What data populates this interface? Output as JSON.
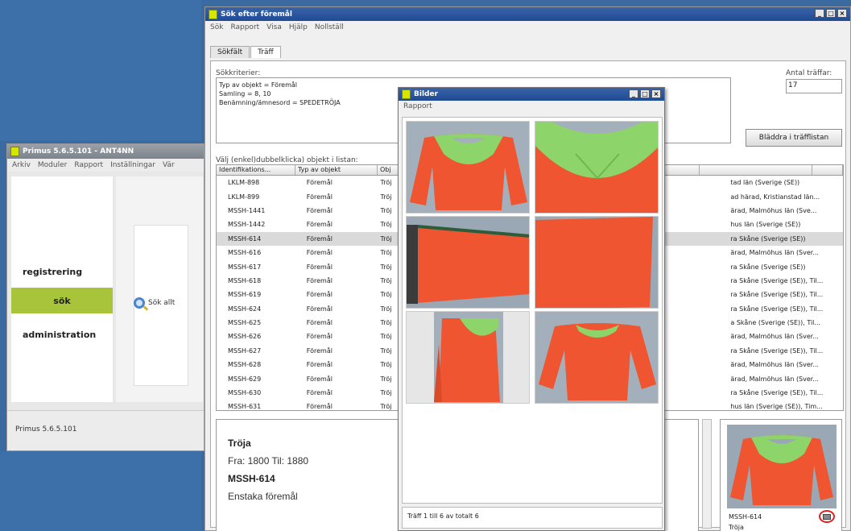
{
  "primus": {
    "title": "Primus 5.6.5.101 - ANT4NN",
    "menu": [
      "Arkiv",
      "Moduler",
      "Rapport",
      "Inställningar",
      "Vär"
    ],
    "nav": [
      "registrering",
      "sök",
      "administration"
    ],
    "side_link": "Sök allt",
    "status": "Primus 5.6.5.101"
  },
  "search": {
    "title": "Sök efter föremål",
    "menu": [
      "Sök",
      "Rapport",
      "Visa",
      "Hjälp",
      "Nollställ"
    ],
    "tabs": [
      "Sökfält",
      "Träff"
    ],
    "criteria_label": "Sökkriterier:",
    "criteria_text": "Typ av objekt = Föremål\nSamling = 8, 10\nBenämning/ämnesord = SPEDETRÖJA",
    "hits_label": "Antal träffar:",
    "hits_value": "17",
    "browse_button": "Bläddra i träfflistan",
    "selection_label": "Välj (enkel)dubbelklicka) objekt i listan:",
    "columns": [
      "Identifikations...",
      "Typ av objekt",
      "Obj",
      "",
      ""
    ],
    "rows": [
      [
        "LKLM-898",
        "Föremål",
        "Tröj",
        "tad län (Sverige (SE))"
      ],
      [
        "LKLM-899",
        "Föremål",
        "Tröj",
        "ad härad, Kristianstad län..."
      ],
      [
        "MSSH-1441",
        "Föremål",
        "Tröj",
        "ärad, Malmöhus län (Sve..."
      ],
      [
        "MSSH-1442",
        "Föremål",
        "Tröj",
        "hus län (Sverige (SE))"
      ],
      [
        "MSSH-614",
        "Föremål",
        "Tröj",
        "ra Skåne (Sverige (SE))"
      ],
      [
        "MSSH-616",
        "Föremål",
        "Tröj",
        "ärad, Malmöhus län (Sver..."
      ],
      [
        "MSSH-617",
        "Föremål",
        "Tröj",
        "ra Skåne (Sverige (SE))"
      ],
      [
        "MSSH-618",
        "Föremål",
        "Tröj",
        "ra Skåne (Sverige (SE)), Til..."
      ],
      [
        "MSSH-619",
        "Föremål",
        "Tröj",
        "ra Skåne (Sverige (SE)), Til..."
      ],
      [
        "MSSH-624",
        "Föremål",
        "Tröj",
        "ra Skåne (Sverige (SE)), Til..."
      ],
      [
        "MSSH-625",
        "Föremål",
        "Tröj",
        "a Skåne (Sverige (SE)), Til..."
      ],
      [
        "MSSH-626",
        "Föremål",
        "Tröj",
        "ärad, Malmöhus län (Sver..."
      ],
      [
        "MSSH-627",
        "Föremål",
        "Tröj",
        "ra Skåne (Sverige (SE)), Til..."
      ],
      [
        "MSSH-628",
        "Föremål",
        "Tröj",
        "ärad, Malmöhus län (Sver..."
      ],
      [
        "MSSH-629",
        "Föremål",
        "Tröj",
        "ärad, Malmöhus län (Sver..."
      ],
      [
        "MSSH-630",
        "Föremål",
        "Tröj",
        "ra Skåne (Sverige (SE)), Til..."
      ],
      [
        "MSSH-631",
        "Föremål",
        "Tröj",
        "hus län (Sverige (SE)), Tim..."
      ]
    ],
    "selected_row": 4,
    "detail": {
      "name": "Tröja",
      "dates": "Fra: 1800 Til: 1880",
      "id": "MSSH-614",
      "type": "Enstaka föremål"
    },
    "thumb": {
      "id": "MSSH-614",
      "name": "Tröja"
    }
  },
  "bilder": {
    "title": "Bilder",
    "menu": "Rapport",
    "footer": "Träff 1 till 6 av totalt 6"
  },
  "colors": {
    "sweater_red": "#ee5530",
    "collar_green": "#8dd46a",
    "nav_selected": "#a8c43a",
    "desktop_blue": "#3d6fa8"
  }
}
